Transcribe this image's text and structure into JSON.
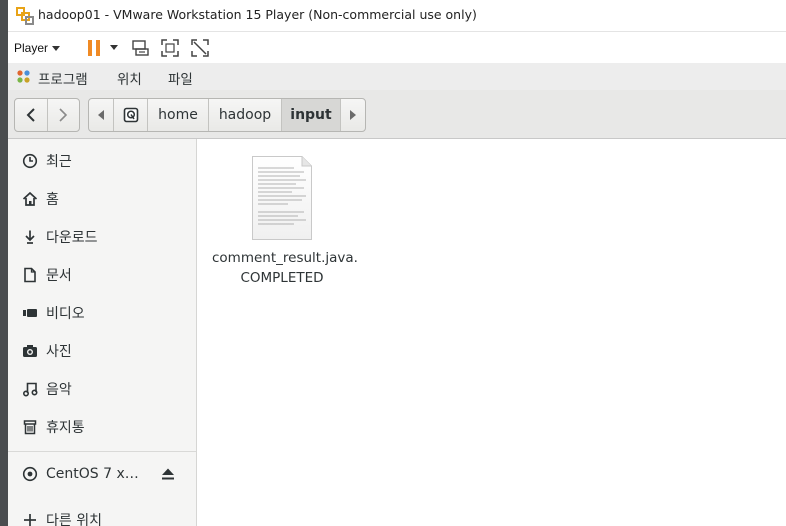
{
  "window": {
    "title": "hadoop01 - VMware Workstation 15 Player (Non-commercial use only)",
    "icon": "vmware-icon"
  },
  "vmware_toolbar": {
    "player_label": "Player",
    "tools": [
      "pause-icon",
      "send-ctrl-alt-del-icon",
      "fullscreen-icon",
      "unity-icon"
    ]
  },
  "gnome_menu": {
    "items": [
      {
        "label": "프로그램",
        "icon": "apps-icon"
      },
      {
        "label": "위치"
      },
      {
        "label": "파일"
      }
    ]
  },
  "pathbar": {
    "crumbs": [
      {
        "label": "",
        "icon": "drive-icon"
      },
      {
        "label": "home"
      },
      {
        "label": "hadoop"
      },
      {
        "label": "input",
        "active": true
      }
    ]
  },
  "sidebar": {
    "items": [
      {
        "label": "최근",
        "icon": "clock-icon"
      },
      {
        "label": "홈",
        "icon": "home-icon"
      },
      {
        "label": "다운로드",
        "icon": "download-icon"
      },
      {
        "label": "문서",
        "icon": "document-icon"
      },
      {
        "label": "비디오",
        "icon": "video-icon"
      },
      {
        "label": "사진",
        "icon": "camera-icon"
      },
      {
        "label": "음악",
        "icon": "music-icon"
      },
      {
        "label": "휴지통",
        "icon": "trash-icon"
      }
    ],
    "devices": [
      {
        "label": "CentOS 7 x…",
        "icon": "disc-icon",
        "eject": "eject-icon"
      }
    ],
    "other": {
      "label": "다른 위치",
      "icon": "plus-icon"
    }
  },
  "files": [
    {
      "name_line1": "comment_result.java.",
      "name_line2": "COMPLETED",
      "icon": "text-file-icon"
    }
  ]
}
